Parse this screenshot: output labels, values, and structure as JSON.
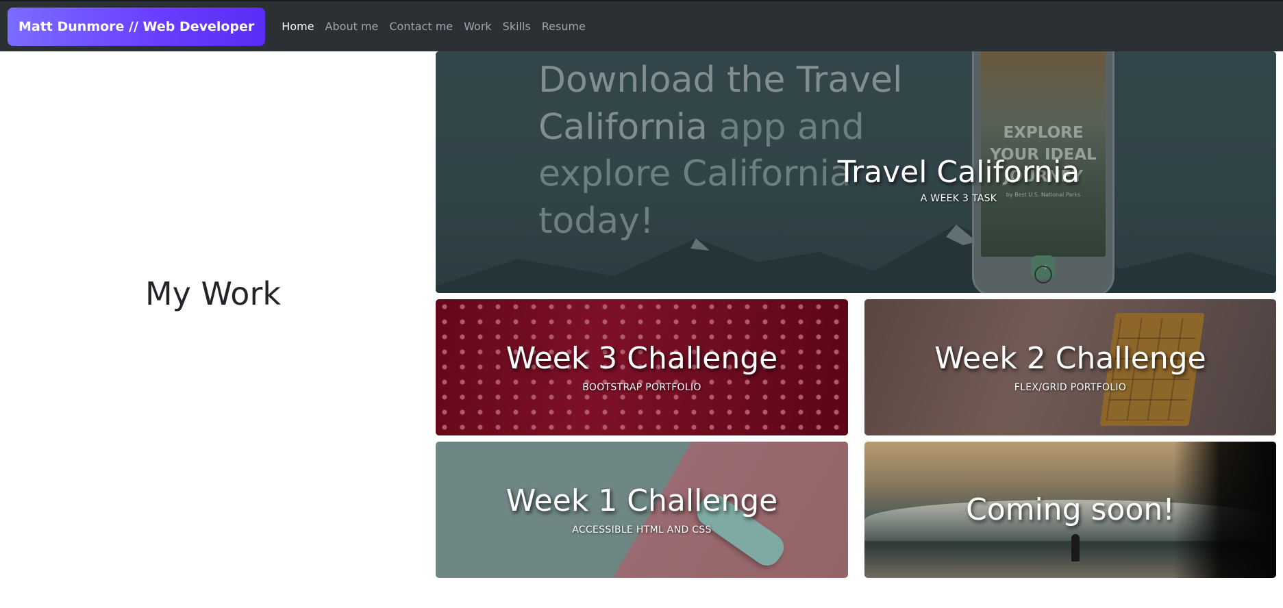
{
  "navbar": {
    "brand": "Matt Dunmore // Web Developer",
    "links": [
      {
        "label": "Home",
        "active": true
      },
      {
        "label": "About me",
        "active": false
      },
      {
        "label": "Contact me",
        "active": false
      },
      {
        "label": "Work",
        "active": false
      },
      {
        "label": "Skills",
        "active": false
      },
      {
        "label": "Resume",
        "active": false
      }
    ]
  },
  "section": {
    "heading": "My Work"
  },
  "cards": {
    "travel": {
      "title": "Travel California",
      "subtitle": "A week 3 task",
      "promo_line_1a": "Download the Travel",
      "promo_line_2a": "California",
      "promo_line_2b": " app and",
      "promo_line_3": "explore California",
      "promo_line_4": "today!",
      "phone_heading_1": "EXPLORE",
      "phone_heading_2": "YOUR IDEAL",
      "phone_heading_3": "JOURNEY",
      "phone_small": "by Best U.S. National Parks",
      "phone_arrow": "→"
    },
    "week3": {
      "title": "Week 3 Challenge",
      "subtitle": "Bootstrap portfolio"
    },
    "week2": {
      "title": "Week 2 Challenge",
      "subtitle": "Flex/Grid Portfolio"
    },
    "week1": {
      "title": "Week 1 Challenge",
      "subtitle": "Accessible HTML and CSS"
    },
    "soon": {
      "title": "Coming soon!"
    }
  },
  "colors": {
    "navbar_bg": "#2b3035",
    "brand_gradient_start": "#7a6dff",
    "brand_gradient_end": "#5b2cf5",
    "nav_active": "#ffffff",
    "nav_inactive": "#a3a7ab"
  }
}
